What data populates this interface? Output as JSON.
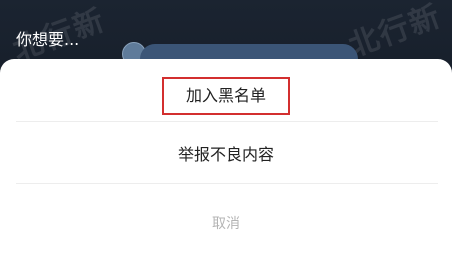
{
  "background": {
    "prompt": "你想要...",
    "watermark": [
      "北行新",
      "北行新"
    ]
  },
  "action_sheet": {
    "options": [
      {
        "label": "加入黑名单",
        "highlighted": true
      },
      {
        "label": "举报不良内容"
      }
    ],
    "cancel_label": "取消"
  },
  "colors": {
    "highlight_border": "#d32f2f",
    "sheet_background": "#ffffff",
    "backdrop": "#10151f"
  }
}
